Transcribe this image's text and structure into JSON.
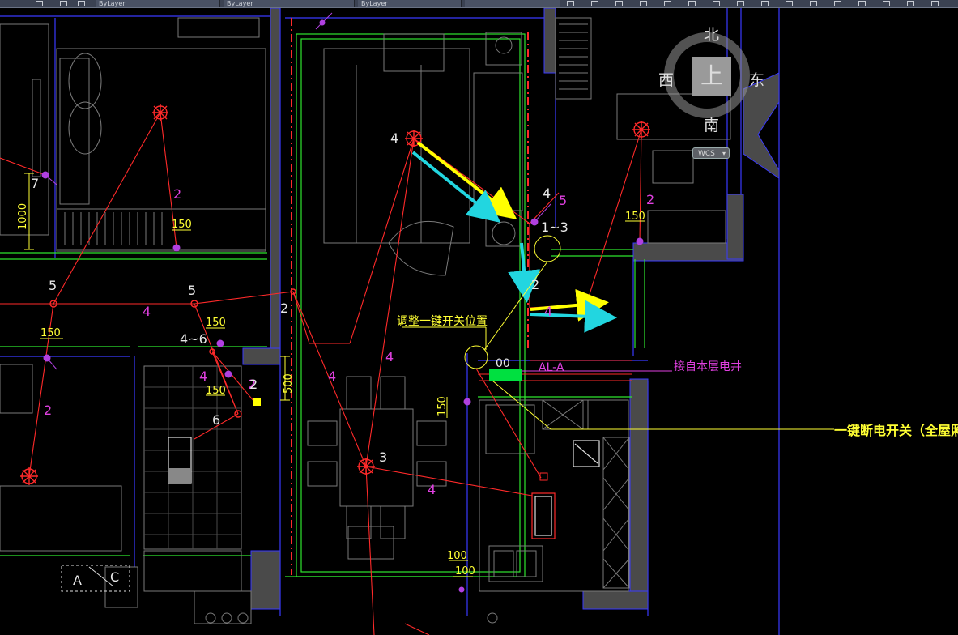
{
  "toolbar": {
    "tabs": [
      "ByLayer",
      "ByLayer",
      "ByLayer"
    ]
  },
  "viewcube": {
    "north": "北",
    "south": "南",
    "east": "东",
    "west": "西",
    "top": "上",
    "wcs": "WCS"
  },
  "annotations": {
    "adjust_switch": "调整一键开关位置",
    "one_key_switch": "一键断电开关（全屋照",
    "from_floor_shaft": "接自本层电井",
    "al_a": "AL-A",
    "box_code": "00"
  },
  "circuit_numbers": {
    "n4a": "4",
    "n4b": "4",
    "n5a": "5",
    "n13": "1~3",
    "n2a": "2",
    "n2b": "2",
    "n4c": "4",
    "n2c": "2",
    "n4d": "4",
    "n4e": "4",
    "n3": "3",
    "n4f": "4",
    "n5b": "5",
    "n5c": "5",
    "n4g": "4",
    "n2d": "2",
    "n4to6": "4~6",
    "n4h": "4",
    "n2e": "2",
    "n6": "6",
    "n2f": "2",
    "n7": "7",
    "n2g": "2"
  },
  "dimensions": {
    "d150a": "150",
    "d150b": "150",
    "d150c": "150",
    "d150d": "150",
    "d150e": "150",
    "d150f": "150",
    "d1000": "1000",
    "d500": "500",
    "d100a": "100",
    "d100b": "100"
  },
  "labels": {
    "a": "A",
    "c": "C"
  },
  "colors": {
    "wall": "#2ee62e",
    "wire": "#ff2a2a",
    "dimension": "#ffff33",
    "circuit_number": "#e040e0",
    "arrow_yellow": "#ffff00",
    "arrow_cyan": "#22d6e0",
    "blue_wall": "#3a3aff",
    "fixture": "#bebebe",
    "panel": "#00e040"
  }
}
